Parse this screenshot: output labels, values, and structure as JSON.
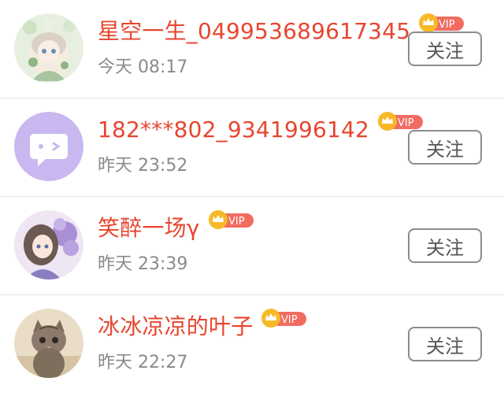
{
  "follow_list": {
    "items": [
      {
        "name": "星空一生_049953689617345",
        "time": "今天 08:17",
        "badge": "VIP",
        "button": "关注",
        "avatar": "anime-girl-flower-crown"
      },
      {
        "name": "182***802_9341996142",
        "time": "昨天 23:52",
        "badge": "VIP",
        "button": "关注",
        "avatar": "chat-bubble-default"
      },
      {
        "name": "笑醉一场γ",
        "time": "昨天 23:39",
        "badge": "VIP",
        "button": "关注",
        "avatar": "anime-girl-purple-flowers"
      },
      {
        "name": "冰冰凉凉的叶子",
        "time": "昨天 22:27",
        "badge": "VIP",
        "button": "关注",
        "avatar": "kitten-photo"
      }
    ]
  },
  "colors": {
    "name": "#e8452f",
    "time": "#8a8a8a",
    "vip_badge": "#f26b61",
    "crown": "#f7b928",
    "default_avatar_bg": "#c9b8f0"
  }
}
